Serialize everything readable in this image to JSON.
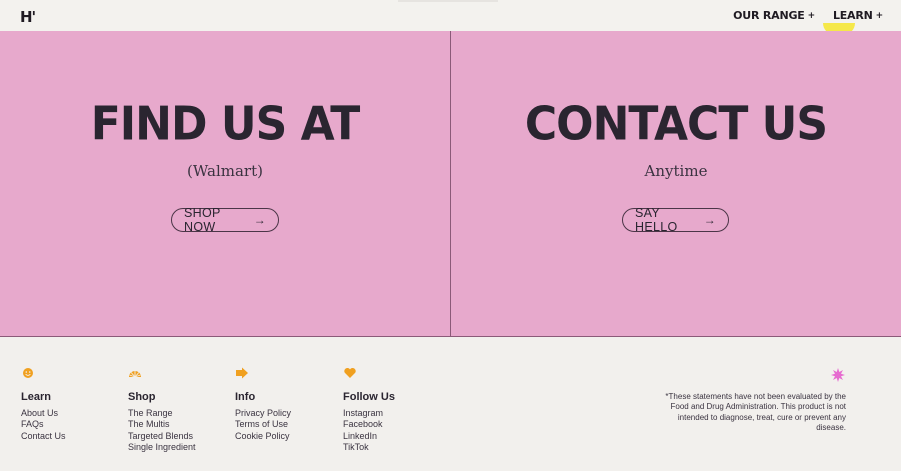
{
  "header": {
    "logo": "H'",
    "nav": [
      {
        "label": "OUR RANGE",
        "plus": "+"
      },
      {
        "label": "LEARN",
        "plus": "+"
      }
    ]
  },
  "hero": {
    "left": {
      "heading": "FIND US AT",
      "sub": "(Walmart)",
      "button": "SHOP NOW",
      "arrow": "→"
    },
    "right": {
      "heading": "CONTACT US",
      "sub": "Anytime",
      "button": "SAY HELLO",
      "arrow": "→"
    },
    "background": "#e7a9cc"
  },
  "footer": {
    "columns": [
      {
        "title": "Learn",
        "icon": "smiley-icon",
        "links": [
          "About Us",
          "FAQs",
          "Contact Us"
        ]
      },
      {
        "title": "Shop",
        "icon": "sunrise-icon",
        "links": [
          "The Range",
          "The Multis",
          "Targeted Blends",
          "Single Ingredient"
        ]
      },
      {
        "title": "Info",
        "icon": "arrow-right-icon",
        "links": [
          "Privacy Policy",
          "Terms of Use",
          "Cookie Policy"
        ]
      },
      {
        "title": "Follow Us",
        "icon": "heart-icon",
        "links": [
          "Instagram",
          "Facebook",
          "LinkedIn",
          "TikTok"
        ]
      }
    ],
    "disclaimer": "*These statements have not been evaluated by the Food and Drug Administration. This product is not intended to diagnose, treat, cure or prevent any disease.",
    "accent": "#f0a020",
    "burst_color": "#e66bd0"
  }
}
